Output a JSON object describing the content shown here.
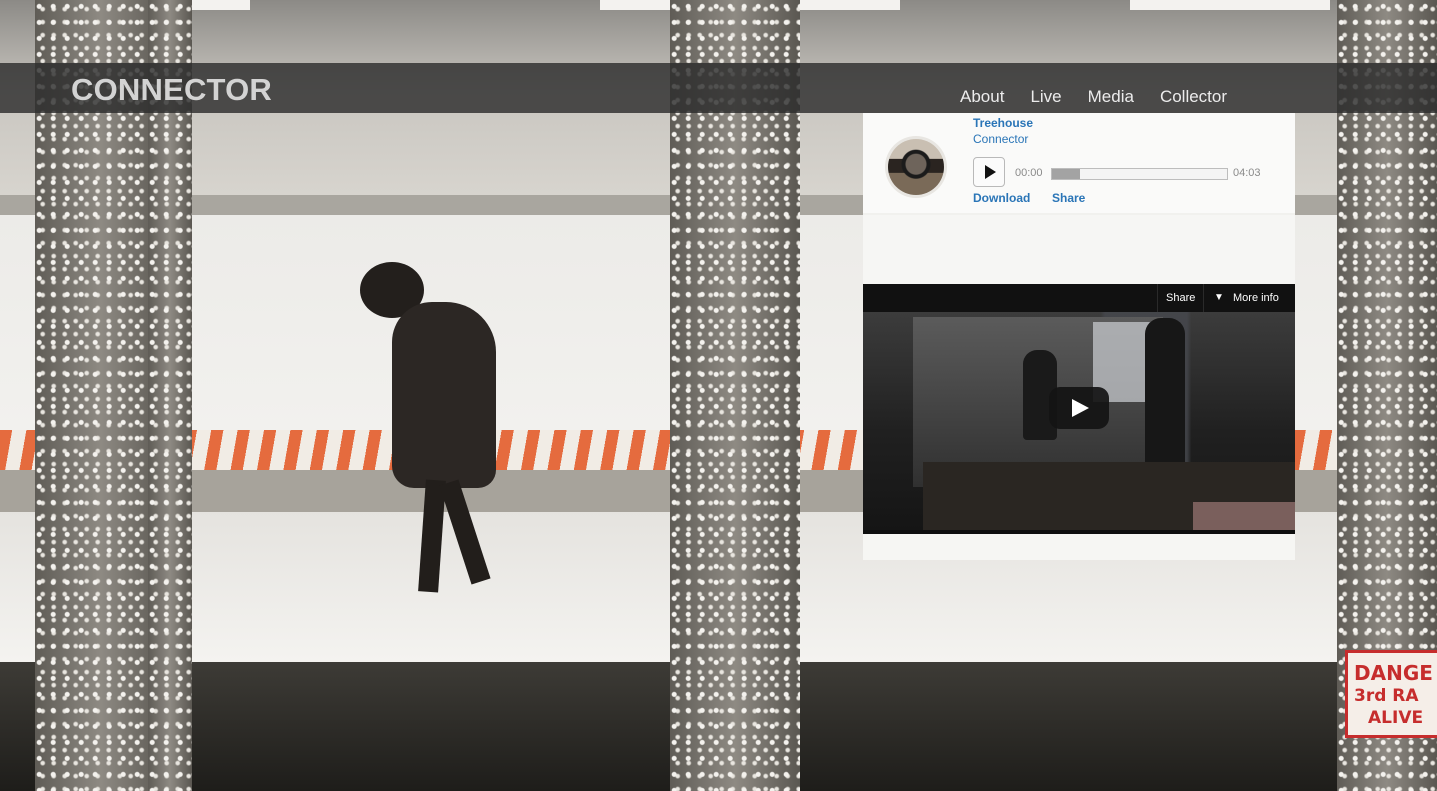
{
  "site": {
    "title": "CONNECTOR"
  },
  "nav": {
    "items": [
      "About",
      "Live",
      "Media",
      "Collector"
    ]
  },
  "player": {
    "track_title": "Treehouse",
    "artist": "Connector",
    "time_current": "00:00",
    "time_total": "04:03",
    "progress_fraction": 0.16,
    "download_label": "Download",
    "share_label": "Share",
    "play_icon": "play-icon",
    "link_color": "#2a75b7"
  },
  "video": {
    "share_label": "Share",
    "more_info_label": "More info",
    "more_info_icon": "double-chevron-down-icon",
    "play_icon": "play-icon"
  },
  "background": {
    "sign_lines": [
      "DANGE",
      "3rd RA",
      "ALIVE"
    ]
  }
}
